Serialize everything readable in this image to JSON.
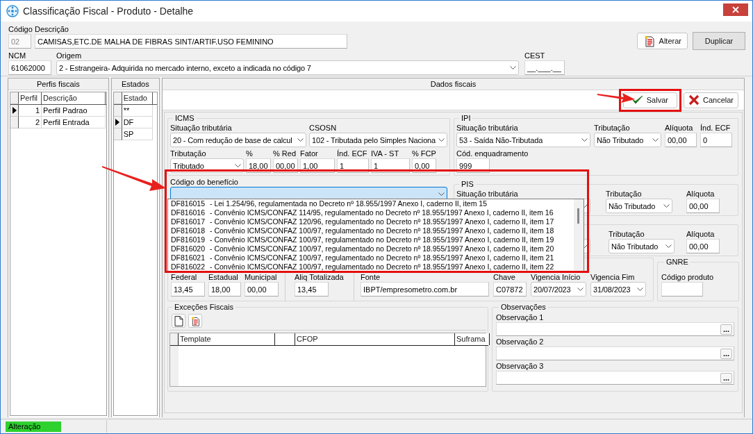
{
  "window": {
    "title": "Classificação Fiscal - Produto - Detalhe"
  },
  "header": {
    "codigo": {
      "label": "Código",
      "value": "02",
      "disabled": true
    },
    "descricao": {
      "label": "Descrição",
      "value": "CAMISAS,ETC.DE MALHA DE FIBRAS SINT/ARTIF.USO FEMININO"
    },
    "ncm": {
      "label": "NCM",
      "value": "61062000"
    },
    "origem": {
      "label": "Origem",
      "value": "2 - Estrangeira- Adquirida no mercado interno, exceto a indicada no código 7",
      "kind": "combo"
    },
    "cest": {
      "label": "CEST",
      "value": "__.___.__"
    },
    "buttons": [
      {
        "label": "Alterar",
        "kind": "edit"
      },
      {
        "label": "Duplicar",
        "kind": "plain"
      }
    ]
  },
  "perfis": {
    "title": "Perfis fiscais",
    "columns": [
      "Perfil",
      "Descrição"
    ],
    "rows": [
      {
        "perfil": "1",
        "descricao": "Perfil Padrao",
        "selected": true
      },
      {
        "perfil": "2",
        "descricao": "Perfil Entrada",
        "selected": false
      }
    ]
  },
  "estados": {
    "title": "Estados",
    "columns": [
      "Estado"
    ],
    "rows": [
      {
        "estado": "**",
        "selected": false
      },
      {
        "estado": "DF",
        "selected": true
      },
      {
        "estado": "SP",
        "selected": false
      }
    ]
  },
  "dados_fiscais": {
    "title": "Dados fiscais",
    "buttons": [
      {
        "label": "Salvar",
        "kind": "save"
      },
      {
        "label": "Cancelar",
        "kind": "cancel"
      }
    ],
    "icms": {
      "title": "ICMS",
      "situacao": {
        "label": "Situação tributária",
        "value": "20 - Com redução de base de calcul",
        "kind": "combo"
      },
      "csosn": {
        "label": "CSOSN",
        "value": "102 - Tributada pelo Simples Naciona",
        "kind": "combo"
      },
      "tributacao": {
        "label": "Tributação",
        "value": "Tributado",
        "kind": "combo"
      },
      "aliquota": {
        "label": "%",
        "value": "18,00"
      },
      "red": {
        "label": "% Red",
        "value": "00,00"
      },
      "fator": {
        "label": "Fator",
        "value": "1,00"
      },
      "ind_ecf": {
        "label": "Índ. ECF",
        "value": "1"
      },
      "iva_st": {
        "label": "IVA - ST",
        "value": "1"
      },
      "fcp": {
        "label": "% FCP",
        "value": "0,00"
      }
    },
    "beneficio": {
      "label": "Código do benefício",
      "kind": "combo",
      "open": true,
      "options": [
        {
          "code": "DF816015",
          "text": "- Lei 1.254/96, regulamentada no Decreto nº 18.955/1997 Anexo I, caderno II, item 15"
        },
        {
          "code": "DF816016",
          "text": "- Convênio ICMS/CONFAZ 114/95, regulamentado no Decreto nº 18.955/1997 Anexo I, caderno II, item 16"
        },
        {
          "code": "DF816017",
          "text": "- Convênio ICMS/CONFAZ 120/96, regulamentado no Decreto nº 18.955/1997 Anexo I, caderno II, item 17"
        },
        {
          "code": "DF816018",
          "text": "- Convênio ICMS/CONFAZ 100/97, regulamentado no Decreto nº 18.955/1997 Anexo I, caderno II, item 18"
        },
        {
          "code": "DF816019",
          "text": "- Convênio ICMS/CONFAZ 100/97, regulamentado no Decreto nº 18.955/1997 Anexo I, caderno II, item 19"
        },
        {
          "code": "DF816020",
          "text": "- Convênio ICMS/CONFAZ 100/97, regulamentado no Decreto nº 18.955/1997 Anexo I, caderno II, item 20"
        },
        {
          "code": "DF816021",
          "text": "- Convênio ICMS/CONFAZ 100/97, regulamentado no Decreto nº 18.955/1997 Anexo I, caderno II, item 21"
        },
        {
          "code": "DF816022",
          "text": "- Convênio ICMS/CONFAZ 100/97, regulamentado no Decreto nº 18.955/1997 Anexo I, caderno II, item 22"
        }
      ]
    },
    "ipi": {
      "title": "IPI",
      "situacao": {
        "label": "Situação tributária",
        "value": "53 - Saída Não-Tributada",
        "kind": "combo"
      },
      "tributacao": {
        "label": "Tributação",
        "value": "Não Tributado",
        "kind": "combo"
      },
      "aliquota": {
        "label": "Alíquota",
        "value": "00,00"
      },
      "ind_ecf": {
        "label": "Índ. ECF",
        "value": "0"
      },
      "enquadramento": {
        "label": "Cód. enquadramento",
        "value": "999"
      }
    },
    "pis": {
      "title": "PIS",
      "situacao": {
        "label": "Situação tributária",
        "kind": "combo"
      },
      "tributacao": {
        "label": "Tributação",
        "value": "Não Tributado",
        "kind": "combo"
      },
      "aliquota": {
        "label": "Alíquota",
        "value": "00,00"
      }
    },
    "cofins": {
      "tributacao": {
        "label": "Tributação",
        "value": "Não Tributado",
        "kind": "combo"
      },
      "aliquota": {
        "label": "Alíquota",
        "value": "00,00"
      }
    },
    "impostos": {
      "federal": {
        "label": "Federal",
        "value": "13,45"
      },
      "estadual": {
        "label": "Estadual",
        "value": "18,00"
      },
      "municipal": {
        "label": "Municipal",
        "value": "00,00"
      },
      "aliq_totalizada": {
        "label": "Aliq Totalizada",
        "value": "13,45"
      },
      "fonte": {
        "label": "Fonte",
        "value": "IBPT/empresometro.com.br"
      },
      "chave": {
        "label": "Chave",
        "value": "C07872"
      },
      "vigencia_inicio": {
        "label": "Vigencia Início",
        "value": "20/07/2023",
        "kind": "combo"
      },
      "vigencia_fim": {
        "label": "Vigencia Fim",
        "value": "31/08/2023",
        "kind": "combo"
      }
    },
    "gnre": {
      "title": "GNRE",
      "codigo_produto": {
        "label": "Código produto"
      }
    },
    "excecoes": {
      "title": "Exceções Fiscais",
      "columns": [
        "Template",
        "CFOP",
        "Suframa"
      ]
    },
    "observacoes": {
      "title": "Observações",
      "button_label": "...",
      "fields": [
        {
          "label": "Observação 1"
        },
        {
          "label": "Observação 2"
        },
        {
          "label": "Observação 3"
        }
      ]
    }
  },
  "status_bar": {
    "mode": "Alteração"
  }
}
